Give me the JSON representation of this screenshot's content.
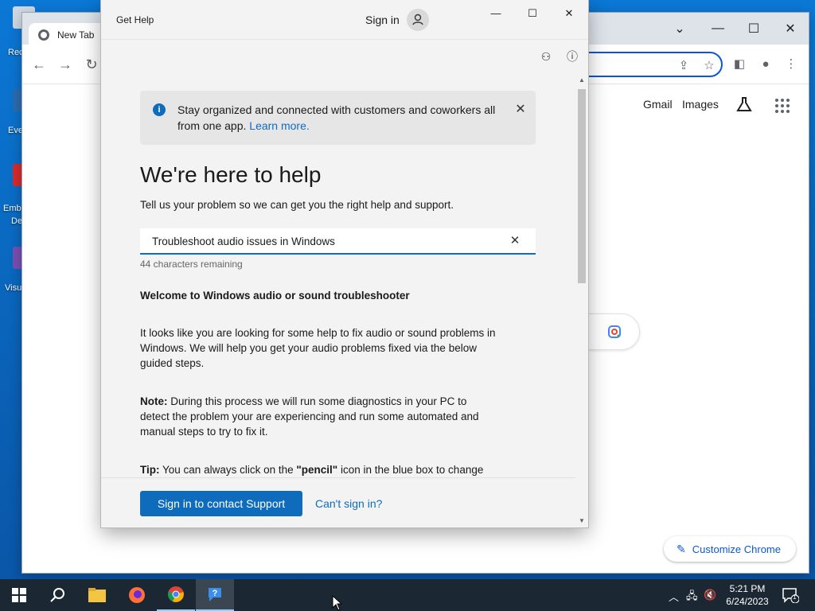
{
  "desktop": {
    "icons": [
      {
        "label": "Rec",
        "color": "#cfd8e3"
      },
      {
        "label": "Eve",
        "color": "#2b6cb0"
      },
      {
        "label": "Emb",
        "label2": "De",
        "color": "#d92b2b"
      },
      {
        "label": "Visu",
        "color": "#7a4fb3"
      }
    ]
  },
  "chrome": {
    "tab_title": "New Tab",
    "links": {
      "gmail": "Gmail",
      "images": "Images"
    },
    "customize_label": "Customize Chrome"
  },
  "get_help": {
    "title": "Get Help",
    "sign_in": "Sign in",
    "banner": {
      "text": "Stay organized and connected with customers and coworkers all from one app.",
      "link": "Learn more."
    },
    "heading": "We're here to help",
    "subheading": "Tell us your problem so we can get you the right help and support.",
    "query_value": "Troubleshoot audio issues in Windows",
    "char_count": "44 characters remaining",
    "welcome_title": "Welcome to Windows audio or sound troubleshooter",
    "intro": "It looks like you are looking for some help to fix audio or sound problems in Windows. We will help you get your audio problems fixed via the below guided steps.",
    "note_label": "Note:",
    "note_text": "During this process we will run some diagnostics in your PC to detect the problem your are experiencing and run some automated  and manual steps to try to fix it.",
    "tip_label": "Tip:",
    "tip_text_1": "You can always click on the",
    "tip_bold": "\"pencil\"",
    "tip_text_2": "icon in the blue box to change",
    "support_button": "Sign in to contact Support",
    "cant_sign_in": "Can't sign in?"
  },
  "taskbar": {
    "time": "5:21 PM",
    "date": "6/24/2023",
    "notification_count": "1"
  },
  "colors": {
    "accent": "#0f6cbd",
    "chrome_blue": "#0b57d0",
    "taskbar": "#1c2734"
  }
}
